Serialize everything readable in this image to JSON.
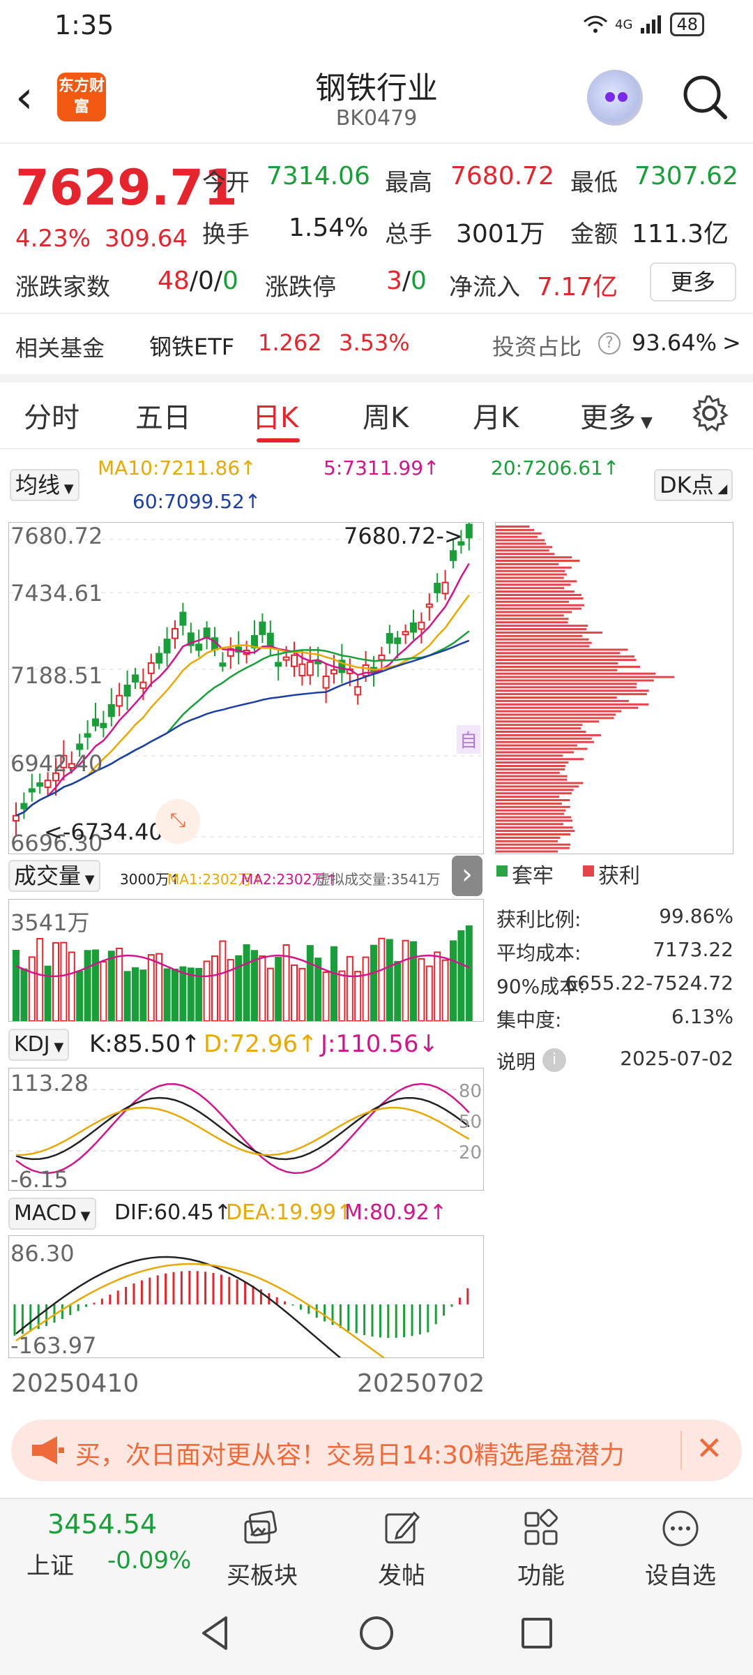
{
  "status": {
    "time": "1:35",
    "network": "4G",
    "battery": "48"
  },
  "header": {
    "logo_text": "东方财富",
    "title": "钢铁行业",
    "code": "BK0479"
  },
  "quote": {
    "price": "7629.71",
    "change_pct": "4.23%",
    "change_val": "309.64",
    "open_label": "今开",
    "open": "7314.06",
    "high_label": "最高",
    "high": "7680.72",
    "low_label": "最低",
    "low": "7307.62",
    "turnover_label": "换手",
    "turnover": "1.54%",
    "volume_label": "总手",
    "volume": "3001万",
    "amount_label": "金额",
    "amount": "111.3亿",
    "breadth_label": "涨跌家数",
    "breadth_up": "48",
    "breadth_sep1": "/",
    "breadth_flat": "0",
    "breadth_sep2": "/",
    "breadth_down": "0",
    "limit_label": "涨跌停",
    "limit_up": "3",
    "limit_sep": "/",
    "limit_down": "0",
    "netflow_label": "净流入",
    "netflow": "7.17亿",
    "more_button": "更多"
  },
  "fund": {
    "label": "相关基金",
    "name": "钢铁ETF",
    "price": "1.262",
    "pct": "3.53%",
    "ratio_label": "投资占比",
    "ratio": "93.64%",
    "arrow": ">"
  },
  "tabs": [
    "分时",
    "五日",
    "日K",
    "周K",
    "月K",
    "更多"
  ],
  "active_tab": "日K",
  "ma": {
    "selector": "均线",
    "ma10": "MA10:7211.86↑",
    "ma5": "5:7311.99↑",
    "ma20": "20:7206.61↑",
    "ma60": "60:7099.52↑",
    "dk_button": "DK点"
  },
  "kline": {
    "top_price": "7680.72",
    "level2": "7434.61",
    "level3": "7188.51",
    "level4": "6942.40",
    "bottom_price": "6696.30",
    "max_marker": "7680.72->",
    "min_marker": "<-6734.40",
    "self_label": "自"
  },
  "volume": {
    "selector": "成交量",
    "v": "3000万↑",
    "ma1": "MA1:2302万↑",
    "ma2": "MA2:2302万↑",
    "virtual": "虚拟成交量:3541万",
    "top": "3541万"
  },
  "kdj": {
    "selector": "KDJ",
    "k": "K:85.50↑",
    "d": "D:72.96↑",
    "j": "J:110.56↓",
    "top": "113.28",
    "bottom": "-6.15",
    "l80": "80",
    "l50": "50",
    "l20": "20"
  },
  "macd": {
    "selector": "MACD",
    "dif": "DIF:60.45↑",
    "dea": "DEA:19.99↑",
    "m": "M:80.92↑",
    "top": "86.30",
    "bottom": "-163.97"
  },
  "dates": {
    "start": "20250410",
    "end": "20250702"
  },
  "cost": {
    "legend_trapped": "套牢",
    "legend_profit": "获利",
    "profit_ratio_label": "获利比例:",
    "profit_ratio": "99.86%",
    "avg_cost_label": "平均成本:",
    "avg_cost": "7173.22",
    "cost90_label": "90%成本:",
    "cost90": "6655.22-7524.72",
    "concentration_label": "集中度:",
    "concentration": "6.13%",
    "note_label": "说明",
    "date": "2025-07-02"
  },
  "banner": {
    "text": "买，次日面对更从容！交易日14:30精选尾盘潜力"
  },
  "bottom": {
    "index_value": "3454.54",
    "index_name": "上证",
    "index_pct": "-0.09%",
    "items": [
      "买板块",
      "发帖",
      "功能",
      "设自选"
    ]
  },
  "colors": {
    "up": "#e4252d",
    "down": "#1a9e3a",
    "ma5": "#d0168a",
    "ma10": "#e7a900",
    "ma20": "#1a9e3a",
    "ma60": "#1d3ea3"
  }
}
